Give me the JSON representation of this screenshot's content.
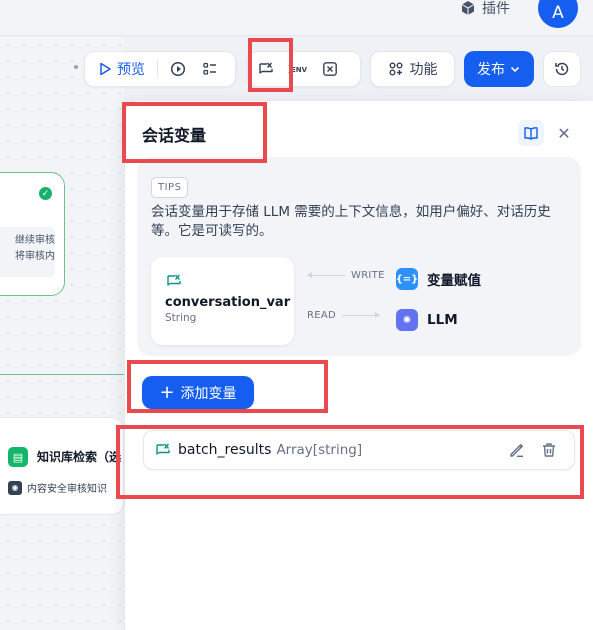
{
  "header": {
    "plugins_label": "插件",
    "avatar_initial": "A"
  },
  "canvas": {
    "node1": {
      "text_line1": "继续审核",
      "text_line2": "将审核内"
    },
    "node2": {
      "title": "知识库检索（选",
      "subtitle": "内容安全审核知识"
    }
  },
  "toolbar": {
    "preview_label": "预览",
    "env_label": "ENV",
    "feature_label": "功能",
    "publish_label": "发布"
  },
  "panel": {
    "title": "会话变量",
    "tips_badge": "TIPS",
    "tips_text": "会话变量用于存储 LLM 需要的上下文信息，如用户偏好、对话历史等。它是可读写的。",
    "example_var_name": "conversation_var",
    "example_var_type": "String",
    "write_label": "WRITE",
    "read_label": "READ",
    "assign_target": "变量赋值",
    "llm_target": "LLM",
    "add_button_label": "添加变量",
    "variables": [
      {
        "name": "batch_results",
        "type": "Array[string]"
      }
    ]
  },
  "colors": {
    "accent": "#155eef",
    "highlight": "#ea4a4f",
    "success": "#17b26a"
  }
}
